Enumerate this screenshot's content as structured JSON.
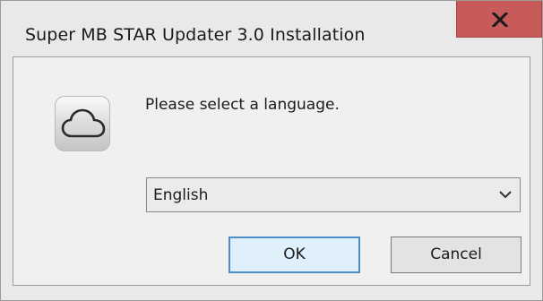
{
  "window": {
    "title": "Super MB STAR Updater 3.0 Installation"
  },
  "dialog": {
    "icon": "cloud-icon",
    "prompt": "Please select a language.",
    "language_select": {
      "selected": "English"
    },
    "buttons": {
      "ok_label": "OK",
      "cancel_label": "Cancel"
    }
  },
  "colors": {
    "close_button": "#c85a5a",
    "ok_button_border": "#4a8ec9",
    "ok_button_fill": "#dff0fb"
  }
}
